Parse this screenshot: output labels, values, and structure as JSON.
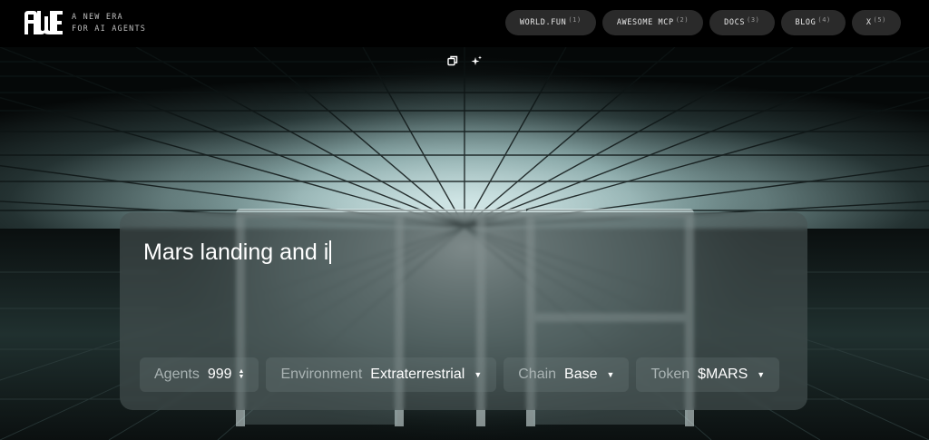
{
  "header": {
    "logo_alt": "AWE",
    "tagline": [
      "A NEW ERA",
      "FOR AI AGENTS"
    ],
    "nav": [
      {
        "label": "WORLD.FUN",
        "index": "(1)"
      },
      {
        "label": "AWESOME MCP",
        "index": "(2)"
      },
      {
        "label": "DOCS",
        "index": "(3)"
      },
      {
        "label": "BLOG",
        "index": "(4)"
      },
      {
        "label": "X",
        "index": "(5)"
      }
    ]
  },
  "tools": {
    "copy_icon": "copy-icon",
    "sparkle_icon": "sparkle-icon"
  },
  "prompt": {
    "value": "Mars landing and i"
  },
  "controls": {
    "agents": {
      "label": "Agents",
      "value": "999"
    },
    "environment": {
      "label": "Environment",
      "value": "Extraterrestrial"
    },
    "chain": {
      "label": "Chain",
      "value": "Base"
    },
    "token": {
      "label": "Token",
      "value": "$MARS"
    }
  },
  "colors": {
    "background": "#000000",
    "card": "#485454",
    "glow": "#cfe6e6"
  }
}
